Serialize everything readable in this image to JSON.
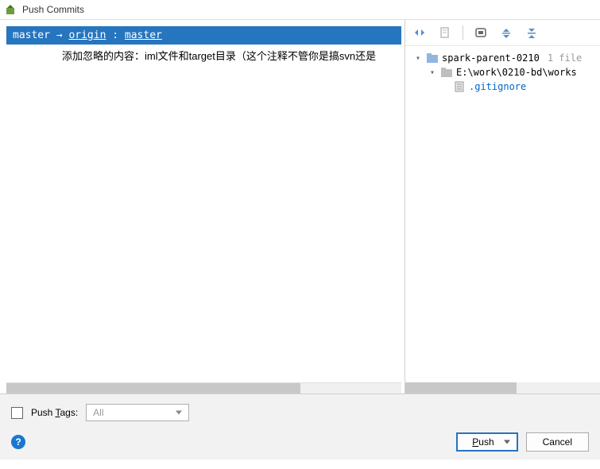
{
  "window": {
    "title": "Push Commits"
  },
  "branch": {
    "local": "master",
    "arrow": "→",
    "remote": "origin",
    "colon": ":",
    "remote_branch": "master"
  },
  "commits": [
    "添加忽略的内容：iml文件和target目录（这个注释不管你是搞svn还是"
  ],
  "tree": {
    "root": {
      "name": "spark-parent-0210",
      "file_count": "1 file"
    },
    "folder": {
      "path": "E:\\work\\0210-bd\\works"
    },
    "file": {
      "name": ".gitignore"
    }
  },
  "footer": {
    "push_tags_label_pre": "Push ",
    "push_tags_label_u": "T",
    "push_tags_label_post": "ags:",
    "combo_value": "All",
    "push_btn_u": "P",
    "push_btn_post": "ush",
    "cancel_btn": "Cancel"
  }
}
